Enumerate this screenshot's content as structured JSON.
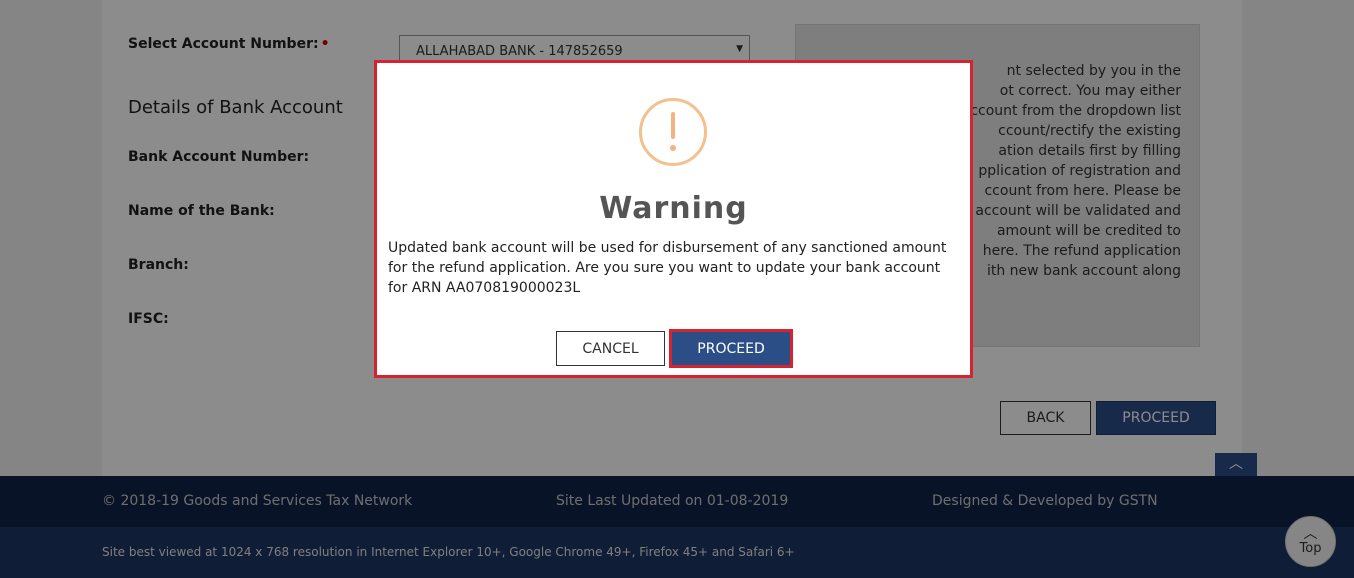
{
  "form": {
    "select_account_label": "Select Account Number:",
    "required_mark": "•",
    "selected_account": "ALLAHABAD BANK - 147852659",
    "section_title": "Details of Bank Account",
    "bank_account_number_label": "Bank Account Number:",
    "bank_name_label": "Name of the Bank:",
    "branch_label": "Branch:",
    "ifsc_label": "IFSC:"
  },
  "info_box": {
    "lines": [
      "nt selected by you in the",
      "ot correct. You may either",
      "ccount from the dropdown list",
      "ccount/rectify the existing",
      "ation details first by filling",
      "pplication of registration and",
      "ccount from here. Please be",
      "account will be validated and",
      "amount will be credited to",
      "here. The refund application",
      "ith new bank account along"
    ]
  },
  "actions": {
    "back_label": "BACK",
    "proceed_label": "PROCEED",
    "top_tab_icon": "chevron-up-icon"
  },
  "footer": {
    "copyright": "© 2018-19 Goods and Services Tax Network",
    "last_updated": "Site Last Updated on 01-08-2019",
    "designed_by": "Designed & Developed by GSTN",
    "browser_note": "Site best viewed at 1024 x 768 resolution in Internet Explorer 10+, Google Chrome 49+, Firefox 45+ and Safari 6+",
    "scroll_top_label": "Top"
  },
  "modal": {
    "icon": "exclamation-circle-icon",
    "title": "Warning",
    "message": "Updated bank account will be used for disbursement of any sanctioned amount for the refund application. Are you sure you want to update your bank account for ARN AA070819000023L",
    "cancel_label": "CANCEL",
    "proceed_label": "PROCEED"
  },
  "colors": {
    "primary": "#2c4e86",
    "highlight_border": "#d7232f",
    "warning_icon": "#f4c08e",
    "footer_dark": "#12244a"
  }
}
